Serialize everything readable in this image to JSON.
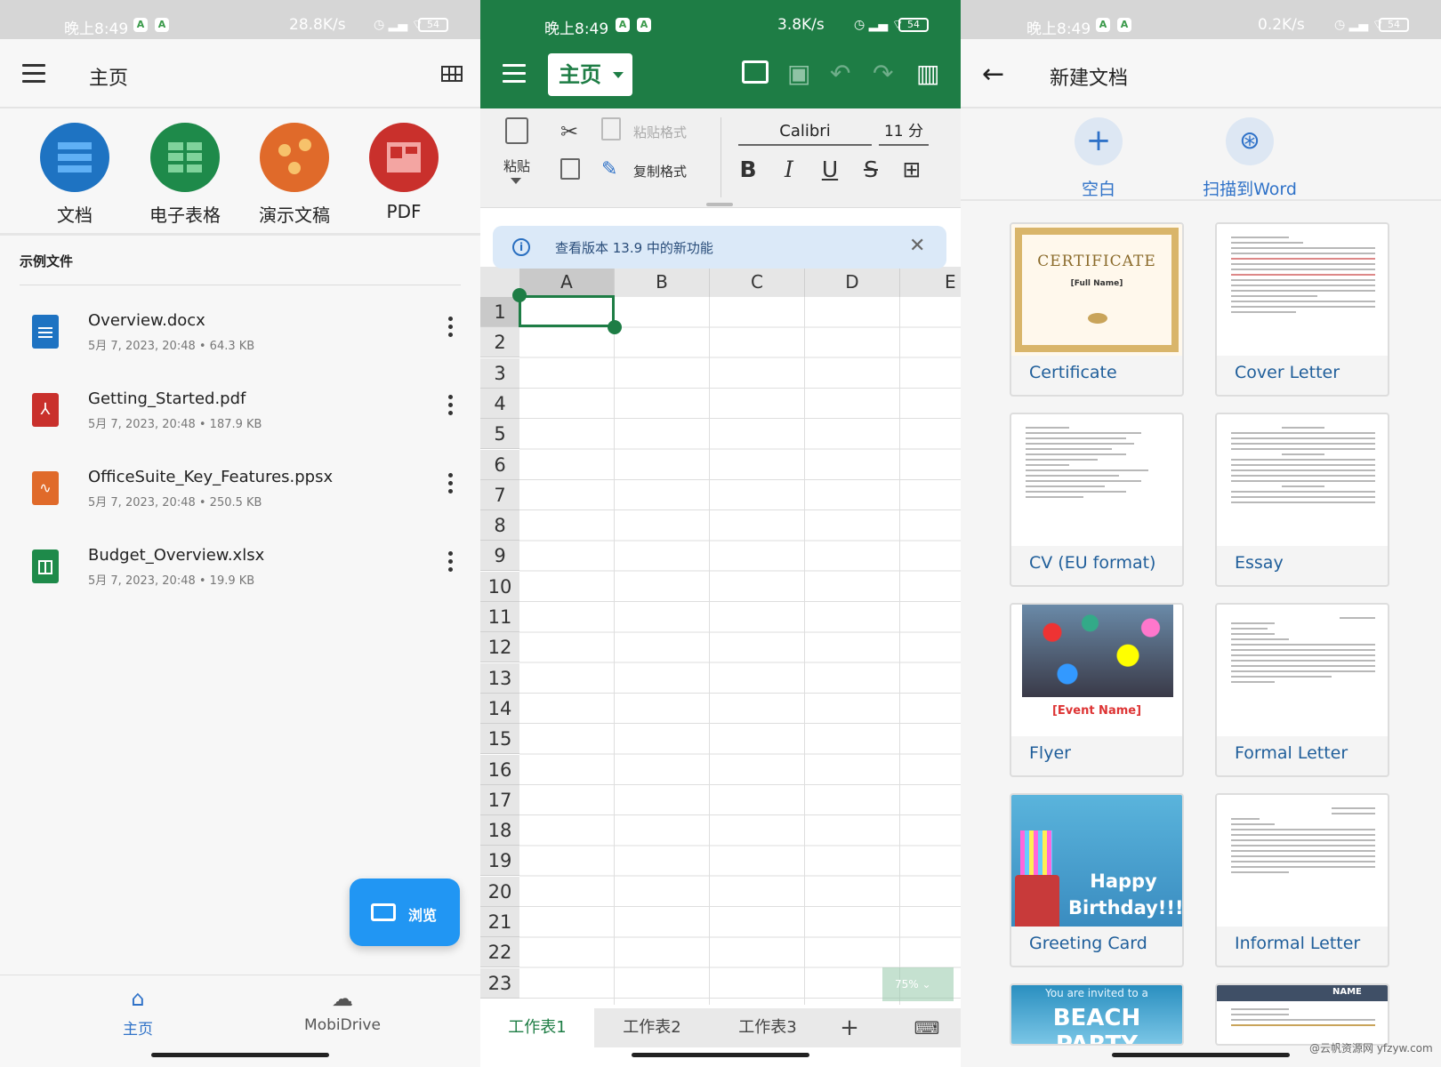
{
  "status_left": {
    "time": "晚上8:49",
    "speed": "28.8K/s",
    "battery": "54"
  },
  "status_mid": {
    "time": "晚上8:49",
    "speed": "3.8K/s",
    "battery": "54"
  },
  "status_right": {
    "time": "晚上8:49",
    "speed": "0.2K/s",
    "battery": "54"
  },
  "home": {
    "title": "主页",
    "apps": [
      {
        "label": "文档",
        "color": "#1e73c2"
      },
      {
        "label": "电子表格",
        "color": "#1e8a4a"
      },
      {
        "label": "演示文稿",
        "color": "#e06a2a"
      },
      {
        "label": "PDF",
        "color": "#c9302c"
      }
    ],
    "section_label": "示例文件",
    "files": [
      {
        "name": "Overview.docx",
        "meta": "5月 7, 2023, 20:48  •  64.3 KB",
        "color": "#1e73c2"
      },
      {
        "name": "Getting_Started.pdf",
        "meta": "5月 7, 2023, 20:48  •  187.9 KB",
        "color": "#c9302c"
      },
      {
        "name": "OfficeSuite_Key_Features.ppsx",
        "meta": "5月 7, 2023, 20:48  •  250.5 KB",
        "color": "#e06a2a"
      },
      {
        "name": "Budget_Overview.xlsx",
        "meta": "5月 7, 2023, 20:48  •  19.9 KB",
        "color": "#1e8a4a"
      }
    ],
    "browse_label": "浏览",
    "nav": {
      "home": "主页",
      "drive": "MobiDrive"
    }
  },
  "sheet": {
    "home_tab": "主页",
    "paste_label": "粘贴",
    "paste_format": "粘贴格式",
    "copy_format": "复制格式",
    "font": "Calibri",
    "font_size": "11 分",
    "banner": "查看版本 13.9 中的新功能",
    "columns": [
      "A",
      "B",
      "C",
      "D",
      "E"
    ],
    "rows": [
      "1",
      "2",
      "3",
      "4",
      "5",
      "6",
      "7",
      "8",
      "9",
      "10",
      "11",
      "12",
      "13",
      "14",
      "15",
      "16",
      "17",
      "18",
      "19",
      "20",
      "21",
      "22",
      "23"
    ],
    "zoom": "75%",
    "tabs": [
      "工作表1",
      "工作表2",
      "工作表3"
    ],
    "accent": "#1e7d45"
  },
  "new_doc": {
    "title": "新建文档",
    "blank": "空白",
    "scan": "扫描到Word",
    "templates": [
      "Certificate",
      "Cover Letter",
      "CV (EU format)",
      "Essay",
      "Flyer",
      "Formal Letter",
      "Greeting Card",
      "Informal Letter"
    ],
    "cert_title": "CERTIFICATE",
    "cert_name": "[Full Name]",
    "flyer_event": "[Event Name]",
    "greeting": "Happy Birthday!!!",
    "beach": "BEACH PARTY",
    "beach_sub": "You are invited to a",
    "name_tag": "NAME"
  },
  "watermark": "@云帆资源网 yfzyw.com"
}
